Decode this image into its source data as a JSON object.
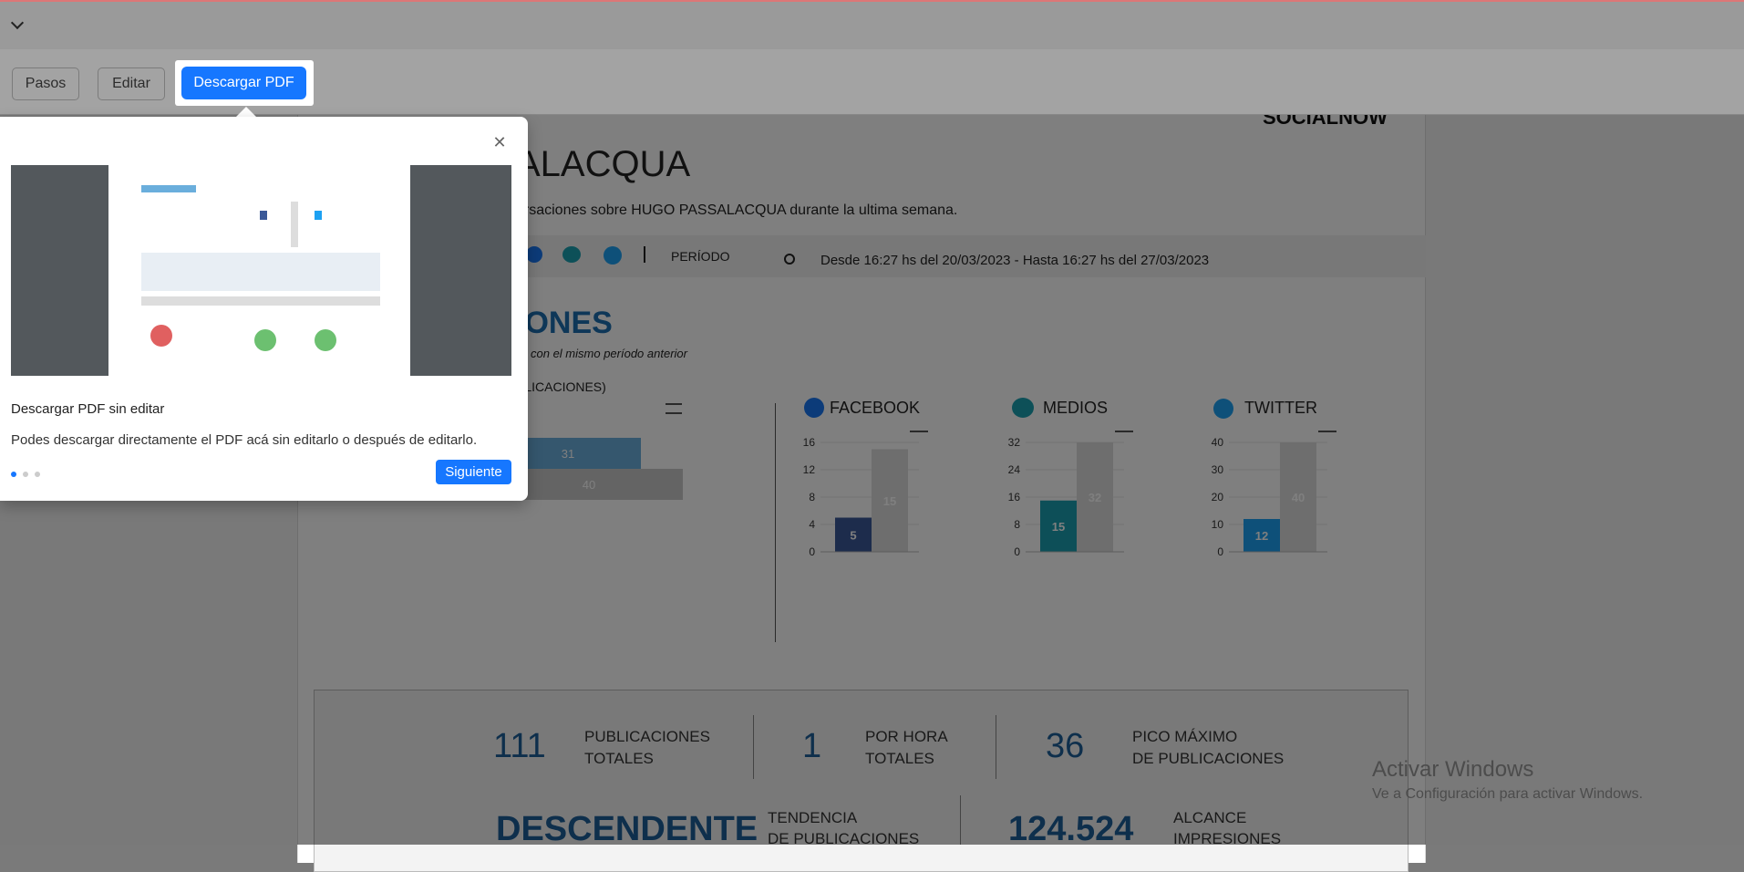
{
  "toolbar": {
    "steps_label": "Pasos",
    "edit_label": "Editar",
    "download_label": "Descargar PDF"
  },
  "report": {
    "brand": "SOCIALNOW",
    "title_partial": "ALACQUA",
    "subtitle_partial": "ersaciones sobre HUGO PASSALACQUA durante la ultima semana.",
    "period_label": "PERÍODO",
    "period_value": "Desde 16:27 hs del 20/03/2023 - Hasta 16:27 hs del 27/03/2023",
    "section_partial": "IONES",
    "section_sub_partial": "con el mismo período anterior",
    "publications_partial": "BLICACIONES)"
  },
  "channels": {
    "facebook": {
      "label": "FACEBOOK",
      "yticks": [
        "16",
        "12",
        "8",
        "4",
        "0"
      ]
    },
    "medios": {
      "label": "MEDIOS",
      "yticks": [
        "32",
        "24",
        "16",
        "8",
        "0"
      ]
    },
    "twitter": {
      "label": "TWITTER",
      "yticks": [
        "40",
        "30",
        "20",
        "10",
        "0"
      ]
    }
  },
  "chart_data": [
    {
      "type": "bar",
      "orientation": "horizontal",
      "values": [
        31,
        40
      ],
      "colors": [
        "#6aaedc",
        "#c8c8c8"
      ]
    },
    {
      "type": "bar",
      "title": "FACEBOOK",
      "values": [
        5,
        15
      ],
      "ylim": [
        0,
        16
      ],
      "colors": [
        "#3b5998",
        "#dcdcdc"
      ]
    },
    {
      "type": "bar",
      "title": "MEDIOS",
      "values": [
        15,
        32
      ],
      "ylim": [
        0,
        32
      ],
      "colors": [
        "#1a9fb0",
        "#dcdcdc"
      ]
    },
    {
      "type": "bar",
      "title": "TWITTER",
      "values": [
        12,
        40
      ],
      "ylim": [
        0,
        40
      ],
      "colors": [
        "#1da1f2",
        "#dcdcdc"
      ]
    }
  ],
  "stats": {
    "total_value": "111",
    "total_l1": "PUBLICACIONES",
    "total_l2": "TOTALES",
    "hour_value": "1",
    "hour_l1": "POR HORA",
    "hour_l2": "TOTALES",
    "peak_value": "36",
    "peak_l1": "PICO MÁXIMO",
    "peak_l2": "DE PUBLICACIONES",
    "trend_value": "DESCENDENTE",
    "trend_l1": "TENDENCIA",
    "trend_l2": "DE PUBLICACIONES",
    "reach_value": "124.524",
    "reach_l1": "ALCANCE",
    "reach_l2": "IMPRESIONES"
  },
  "tour": {
    "title": "Descargar PDF sin editar",
    "description": "Podes descargar directamente el PDF acá sin editarlo o después de editarlo.",
    "next_label": "Siguiente",
    "close_icon": "close-icon"
  },
  "windows": {
    "line1": "Activar Windows",
    "line2": "Ve a Configuración para activar Windows."
  }
}
